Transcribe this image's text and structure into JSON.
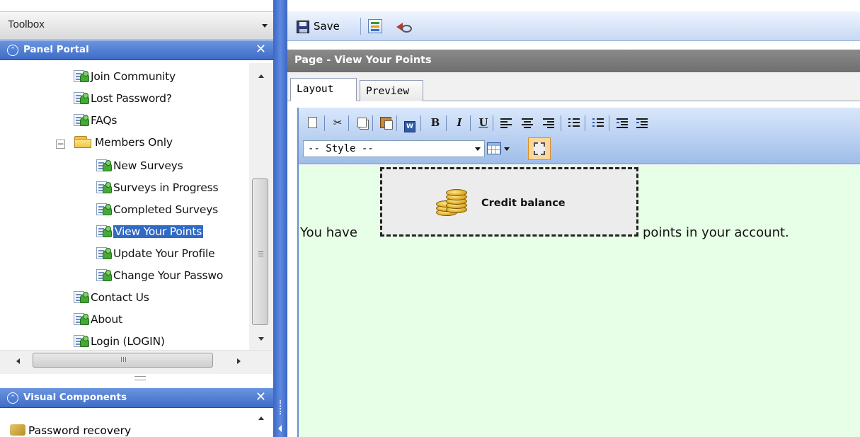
{
  "toolbox": {
    "title": "Toolbox"
  },
  "panel_portal": {
    "title": "Panel Portal",
    "tree": [
      {
        "label": "Join Community",
        "type": "page"
      },
      {
        "label": "Lost Password?",
        "type": "page"
      },
      {
        "label": "FAQs",
        "type": "page"
      },
      {
        "label": "Members Only",
        "type": "folder",
        "expanded": true
      },
      {
        "label": "New Surveys",
        "type": "page"
      },
      {
        "label": "Surveys in Progress",
        "type": "page"
      },
      {
        "label": "Completed Surveys",
        "type": "page"
      },
      {
        "label": "View Your Points",
        "type": "page",
        "selected": true
      },
      {
        "label": "Update Your Profile",
        "type": "page"
      },
      {
        "label": "Change Your Passwo",
        "type": "page"
      },
      {
        "label": "Contact Us",
        "type": "page"
      },
      {
        "label": "About",
        "type": "page"
      },
      {
        "label": "Login (LOGIN)",
        "type": "page"
      }
    ]
  },
  "visual_components": {
    "title": "Visual Components",
    "items": [
      {
        "label": "Password recovery"
      }
    ]
  },
  "main_toolbar": {
    "save_label": "Save"
  },
  "page": {
    "title": "Page - View Your Points",
    "tabs": [
      {
        "label": "Layout",
        "active": true
      },
      {
        "label": "Preview",
        "active": false
      }
    ]
  },
  "editor": {
    "style_select_value": "-- Style --",
    "toolbar_buttons": [
      "new-document",
      "cut",
      "copy",
      "paste",
      "paste-from-word",
      "bold",
      "italic",
      "underline",
      "align-left",
      "align-center",
      "align-right",
      "ordered-list",
      "unordered-list",
      "outdent",
      "indent"
    ],
    "content": {
      "text_before": "You have",
      "component_label": "Credit balance",
      "text_after": "points in your account.",
      "background": "#e6ffe6"
    }
  },
  "colors": {
    "panel_header": "#3e6cc7",
    "selection": "#316ac5",
    "page_header": "#7a7a7a",
    "toolbar": "#c7d8f4"
  }
}
